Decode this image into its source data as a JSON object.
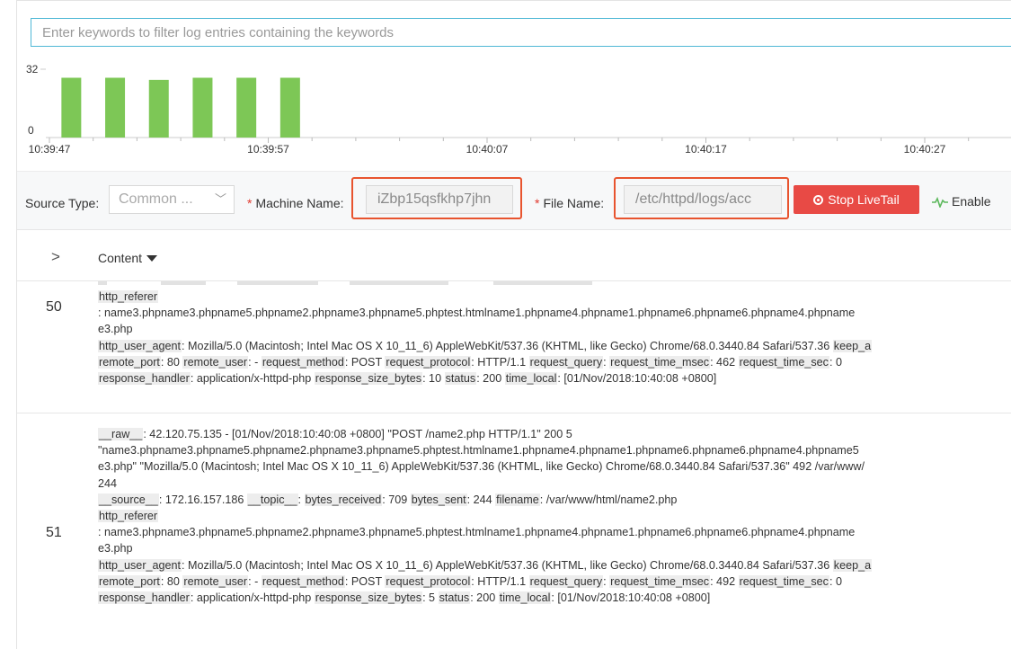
{
  "search": {
    "placeholder": "Enter keywords to filter log entries containing the keywords"
  },
  "histogram": {
    "y_max_label": "32",
    "y_min_label": "0",
    "x_ticks": [
      "10:39:47",
      "10:39:57",
      "10:40:07",
      "10:40:17",
      "10:40:27"
    ],
    "bar_color": "#7dc756",
    "bars": [
      {
        "label": "10:39:48",
        "value": 28
      },
      {
        "label": "10:39:50",
        "value": 28
      },
      {
        "label": "10:39:52",
        "value": 27
      },
      {
        "label": "10:39:54",
        "value": 28
      },
      {
        "label": "10:39:56",
        "value": 28
      },
      {
        "label": "10:39:58",
        "value": 28
      }
    ]
  },
  "filters": {
    "source_type_label": "Source Type:",
    "source_type_value": "Common ...",
    "required_mark": "*",
    "machine_name_label": "Machine Name:",
    "machine_name_value": "iZbp15qsfkhp7jhn",
    "file_name_label": "File Name:",
    "file_name_value": "/etc/httpd/logs/acc",
    "stop_button": "Stop LiveTail",
    "enable_label": "Enable",
    "highlight_color": "#e8542f",
    "stop_color": "#e84a45"
  },
  "table": {
    "expand_glyph": ">",
    "content_header": "Content"
  },
  "rows": [
    {
      "number": "50",
      "lines": [
        [
          {
            "k": "http_referer"
          }
        ],
        [
          {
            "t": ": name3.phpname3.phpname5.phpname2.phpname3.phpname5.phptest.htmlname1.phpname4.phpname1.phpname6.phpname6.phpname4.phpname"
          }
        ],
        [
          {
            "t": "e3.php"
          }
        ],
        [
          {
            "k": "http_user_agent"
          },
          {
            "t": ":  Mozilla/5.0 (Macintosh; Intel Mac OS X 10_11_6) AppleWebKit/537.36 (KHTML, like Gecko) Chrome/68.0.3440.84 Safari/537.36  "
          },
          {
            "k": "keep_a"
          }
        ],
        [
          {
            "k": "remote_port"
          },
          {
            "t": ":  80  "
          },
          {
            "k": "remote_user"
          },
          {
            "t": ":  -  "
          },
          {
            "k": "request_method"
          },
          {
            "t": ":  POST  "
          },
          {
            "k": "request_protocol"
          },
          {
            "t": ":  HTTP/1.1  "
          },
          {
            "k": "request_query"
          },
          {
            "t": ":    "
          },
          {
            "k": "request_time_msec"
          },
          {
            "t": ":  462  "
          },
          {
            "k": "request_time_sec"
          },
          {
            "t": ":  0"
          }
        ],
        [
          {
            "k": "response_handler"
          },
          {
            "t": ":  application/x-httpd-php  "
          },
          {
            "k": "response_size_bytes"
          },
          {
            "t": ":  10  "
          },
          {
            "k": "status"
          },
          {
            "t": ":  200  "
          },
          {
            "k": "time_local"
          },
          {
            "t": ":  [01/Nov/2018:10:40:08 +0800]"
          }
        ]
      ]
    },
    {
      "number": "51",
      "lines": [
        [
          {
            "k": "__raw__"
          },
          {
            "t": ":  42.120.75.135 - [01/Nov/2018:10:40:08 +0800] \"POST /name2.php HTTP/1.1\" 200 5"
          }
        ],
        [
          {
            "t": "\"name3.phpname3.phpname5.phpname2.phpname3.phpname5.phptest.htmlname1.phpname4.phpname1.phpname6.phpname6.phpname4.phpname5"
          }
        ],
        [
          {
            "t": "e3.php\" \"Mozilla/5.0 (Macintosh; Intel Mac OS X 10_11_6) AppleWebKit/537.36 (KHTML, like Gecko) Chrome/68.0.3440.84 Safari/537.36\" 492 /var/www/"
          }
        ],
        [
          {
            "t": "244"
          }
        ],
        [
          {
            "k": "__source__"
          },
          {
            "t": ":  172.16.157.186  "
          },
          {
            "k": "__topic__"
          },
          {
            "t": ":    "
          },
          {
            "k": "bytes_received"
          },
          {
            "t": ":  709  "
          },
          {
            "k": "bytes_sent"
          },
          {
            "t": ":  244  "
          },
          {
            "k": "filename"
          },
          {
            "t": ":  /var/www/html/name2.php"
          }
        ],
        [
          {
            "k": "http_referer"
          }
        ],
        [
          {
            "t": ": name3.phpname3.phpname5.phpname2.phpname3.phpname5.phptest.htmlname1.phpname4.phpname1.phpname6.phpname6.phpname4.phpname"
          }
        ],
        [
          {
            "t": "e3.php"
          }
        ],
        [
          {
            "k": "http_user_agent"
          },
          {
            "t": ":  Mozilla/5.0 (Macintosh; Intel Mac OS X 10_11_6) AppleWebKit/537.36 (KHTML, like Gecko) Chrome/68.0.3440.84 Safari/537.36  "
          },
          {
            "k": "keep_a"
          }
        ],
        [
          {
            "k": "remote_port"
          },
          {
            "t": ":  80  "
          },
          {
            "k": "remote_user"
          },
          {
            "t": ":  -  "
          },
          {
            "k": "request_method"
          },
          {
            "t": ":  POST  "
          },
          {
            "k": "request_protocol"
          },
          {
            "t": ":  HTTP/1.1  "
          },
          {
            "k": "request_query"
          },
          {
            "t": ":    "
          },
          {
            "k": "request_time_msec"
          },
          {
            "t": ":  492  "
          },
          {
            "k": "request_time_sec"
          },
          {
            "t": ":  0"
          }
        ],
        [
          {
            "k": "response_handler"
          },
          {
            "t": ":  application/x-httpd-php  "
          },
          {
            "k": "response_size_bytes"
          },
          {
            "t": ":  5  "
          },
          {
            "k": "status"
          },
          {
            "t": ":  200  "
          },
          {
            "k": "time_local"
          },
          {
            "t": ":  [01/Nov/2018:10:40:08 +0800]"
          }
        ]
      ]
    }
  ]
}
